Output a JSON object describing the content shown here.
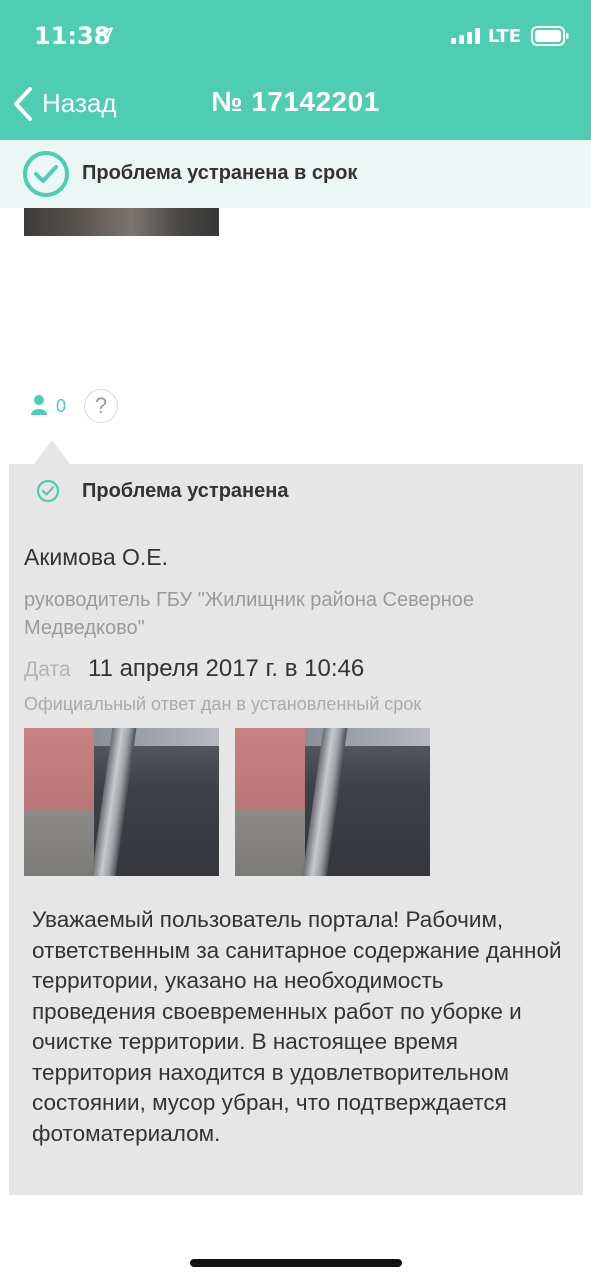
{
  "status_bar": {
    "time": "11:38",
    "network": "LTE",
    "location_icon": "location-arrow-icon",
    "signal_icon": "signal-bars-icon",
    "battery_icon": "battery-icon"
  },
  "nav": {
    "back_label": "Назад",
    "title": "№ 17142201"
  },
  "banner": {
    "text": "Проблема устранена в срок",
    "icon": "check-circle-icon"
  },
  "likes": {
    "count": "0",
    "help_label": "?"
  },
  "response": {
    "status": "Проблема устранена",
    "author": "Акимова О.Е.",
    "position": "руководитель ГБУ \"Жилищник района Северное Медведково\"",
    "date_label": "Дата",
    "date_value": "11 апреля 2017 г. в 10:46",
    "official_note": "Официальный ответ дан в установленный срок",
    "text": "Уважаемый пользователь портала! Рабочим, ответственным за санитарное содержание данной территории, указано на необходимость проведения своевременных работ по уборке и очистке территории. В настоящее время территория находится в удовлетворительном состоянии, мусор убран, что подтверждается фотоматериалом."
  },
  "colors": {
    "accent": "#4fcdb3",
    "banner_bg": "#ebf7f4",
    "card_bg": "#e6e6e6"
  }
}
